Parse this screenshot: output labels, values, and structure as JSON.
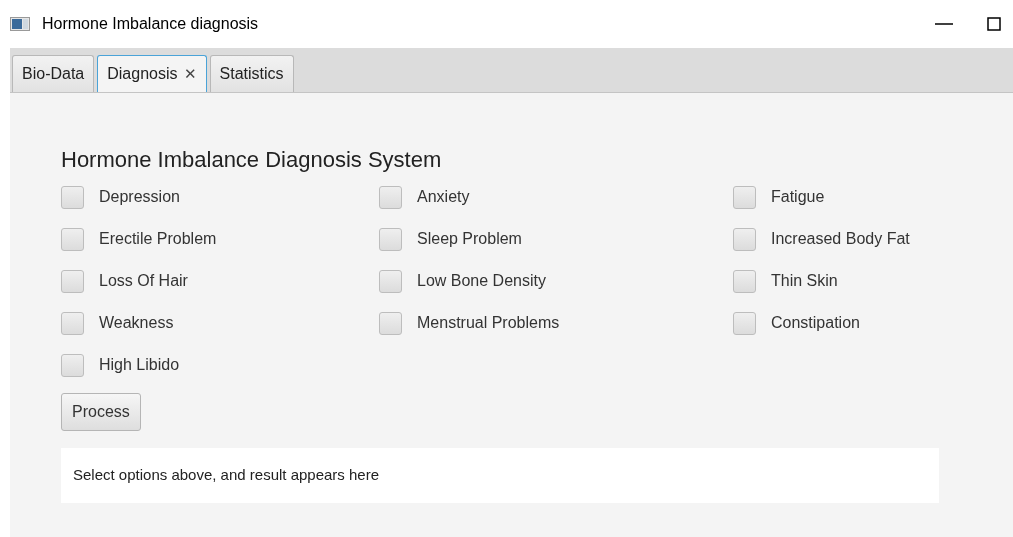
{
  "window": {
    "title": "Hormone Imbalance diagnosis"
  },
  "tabs": [
    {
      "label": "Bio-Data",
      "selected": false
    },
    {
      "label": "Diagnosis",
      "selected": true,
      "close_glyph": "✕"
    },
    {
      "label": "Statistics",
      "selected": false
    }
  ],
  "heading": "Hormone Imbalance Diagnosis System",
  "symptom_columns": [
    [
      {
        "label": "Depression",
        "checked": false
      },
      {
        "label": "Erectile Problem",
        "checked": false
      },
      {
        "label": "Loss Of Hair",
        "checked": false
      },
      {
        "label": "Weakness",
        "checked": false
      },
      {
        "label": "High Libido",
        "checked": false
      }
    ],
    [
      {
        "label": "Anxiety",
        "checked": false
      },
      {
        "label": "Sleep Problem",
        "checked": false
      },
      {
        "label": "Low Bone Density",
        "checked": false
      },
      {
        "label": "Menstrual Problems",
        "checked": false
      }
    ],
    [
      {
        "label": "Fatigue",
        "checked": false
      },
      {
        "label": "Increased Body Fat",
        "checked": false
      },
      {
        "label": "Thin Skin",
        "checked": false
      },
      {
        "label": "Constipation",
        "checked": false
      }
    ]
  ],
  "process_button": "Process",
  "result": "Select options above, and result appears here"
}
